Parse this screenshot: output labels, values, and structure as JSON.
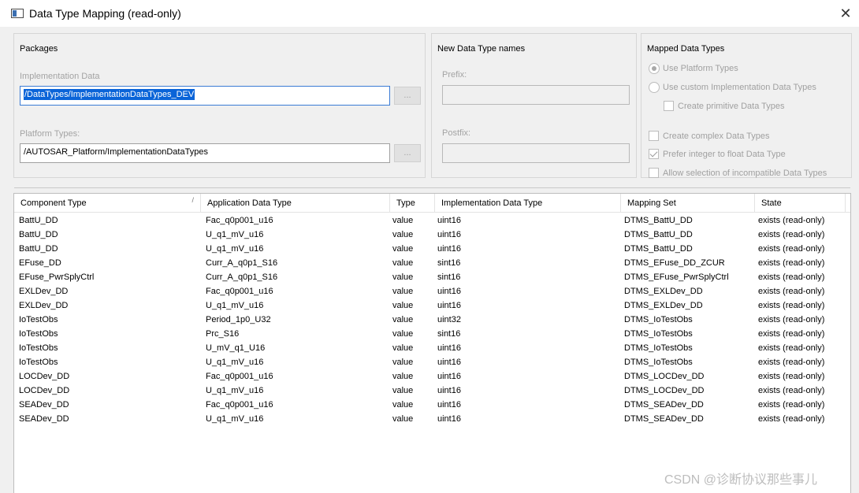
{
  "window": {
    "title": "Data Type Mapping (read-only)",
    "close_glyph": "✕"
  },
  "packages": {
    "title": "Packages",
    "impl_label": "Implementation Data",
    "impl_value": "/DataTypes/ImplementationDataTypes_DEV",
    "platform_label": "Platform Types:",
    "platform_value": "/AUTOSAR_Platform/ImplementationDataTypes",
    "browse_label": "..."
  },
  "names": {
    "title": "New Data Type names",
    "prefix_label": "Prefix:",
    "prefix_value": "",
    "postfix_label": "Postfix:",
    "postfix_value": ""
  },
  "mapped": {
    "title": "Mapped Data Types",
    "use_platform": "Use Platform Types",
    "use_custom": "Use custom Implementation Data Types",
    "create_primitive": "Create primitive Data Types",
    "create_complex": "Create complex Data Types",
    "prefer_integer": "Prefer integer to float Data Type",
    "allow_incompatible": "Allow selection of incompatible Data Types"
  },
  "table": {
    "columns": [
      "Component Type",
      "Application Data Type",
      "Type",
      "Implementation Data Type",
      "Mapping Set",
      "State"
    ],
    "sort_glyph": "/",
    "rows": [
      [
        "BattU_DD",
        "Fac_q0p001_u16",
        "value",
        "uint16",
        "DTMS_BattU_DD",
        "exists (read-only)"
      ],
      [
        "BattU_DD",
        "U_q1_mV_u16",
        "value",
        "uint16",
        "DTMS_BattU_DD",
        "exists (read-only)"
      ],
      [
        "BattU_DD",
        "U_q1_mV_u16",
        "value",
        "uint16",
        "DTMS_BattU_DD",
        "exists (read-only)"
      ],
      [
        "EFuse_DD",
        "Curr_A_q0p1_S16",
        "value",
        "sint16",
        "DTMS_EFuse_DD_ZCUR",
        "exists (read-only)"
      ],
      [
        "EFuse_PwrSplyCtrl",
        "Curr_A_q0p1_S16",
        "value",
        "sint16",
        "DTMS_EFuse_PwrSplyCtrl",
        "exists (read-only)"
      ],
      [
        "EXLDev_DD",
        "Fac_q0p001_u16",
        "value",
        "uint16",
        "DTMS_EXLDev_DD",
        "exists (read-only)"
      ],
      [
        "EXLDev_DD",
        "U_q1_mV_u16",
        "value",
        "uint16",
        "DTMS_EXLDev_DD",
        "exists (read-only)"
      ],
      [
        "IoTestObs",
        "Period_1p0_U32",
        "value",
        "uint32",
        "DTMS_IoTestObs",
        "exists (read-only)"
      ],
      [
        "IoTestObs",
        "Prc_S16",
        "value",
        "sint16",
        "DTMS_IoTestObs",
        "exists (read-only)"
      ],
      [
        "IoTestObs",
        "U_mV_q1_U16",
        "value",
        "uint16",
        "DTMS_IoTestObs",
        "exists (read-only)"
      ],
      [
        "IoTestObs",
        "U_q1_mV_u16",
        "value",
        "uint16",
        "DTMS_IoTestObs",
        "exists (read-only)"
      ],
      [
        "LOCDev_DD",
        "Fac_q0p001_u16",
        "value",
        "uint16",
        "DTMS_LOCDev_DD",
        "exists (read-only)"
      ],
      [
        "LOCDev_DD",
        "U_q1_mV_u16",
        "value",
        "uint16",
        "DTMS_LOCDev_DD",
        "exists (read-only)"
      ],
      [
        "SEADev_DD",
        "Fac_q0p001_u16",
        "value",
        "uint16",
        "DTMS_SEADev_DD",
        "exists (read-only)"
      ],
      [
        "SEADev_DD",
        "U_q1_mV_u16",
        "value",
        "uint16",
        "DTMS_SEADev_DD",
        "exists (read-only)"
      ]
    ]
  },
  "watermark": "CSDN @诊断协议那些事儿"
}
